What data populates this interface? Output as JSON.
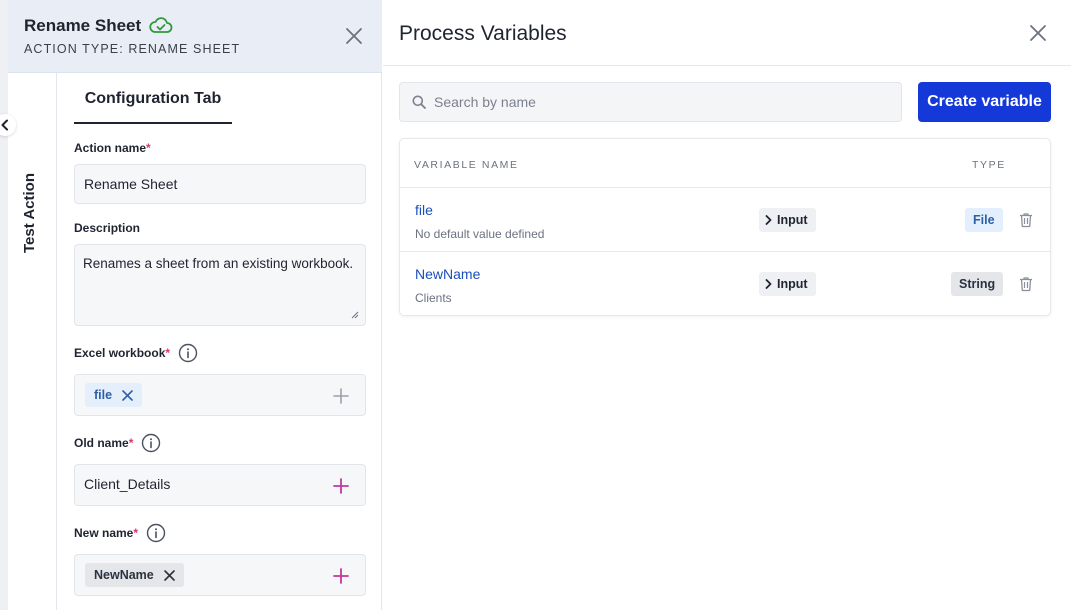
{
  "left_panel": {
    "title": "Rename Sheet",
    "subtitle": "ACTION TYPE: RENAME SHEET",
    "side_tab": "Test Action",
    "active_tab": "Configuration Tab",
    "fields": {
      "action_name": {
        "label": "Action name",
        "required": "*",
        "value": "Rename Sheet"
      },
      "description": {
        "label": "Description",
        "value": "Renames a sheet from an existing workbook."
      },
      "excel_workbook": {
        "label": "Excel workbook",
        "required": "*",
        "chip": "file"
      },
      "old_name": {
        "label": "Old name",
        "required": "*",
        "value": "Client_Details"
      },
      "new_name": {
        "label": "New name",
        "required": "*",
        "chip": "NewName"
      }
    }
  },
  "right_panel": {
    "title": "Process Variables",
    "search_placeholder": "Search by name",
    "create_button": "Create variable",
    "columns": {
      "name": "VARIABLE NAME",
      "type": "TYPE"
    },
    "variables": [
      {
        "name": "file",
        "description": "No default value defined",
        "direction": "Input",
        "type": "File"
      },
      {
        "name": "NewName",
        "description": "Clients",
        "direction": "Input",
        "type": "String"
      }
    ]
  },
  "colors": {
    "accent": "#1538d8",
    "header_bg": "#e9eef6",
    "success": "#2f9a3c",
    "plus_magenta": "#c2389b",
    "link": "#1a4fb8"
  }
}
